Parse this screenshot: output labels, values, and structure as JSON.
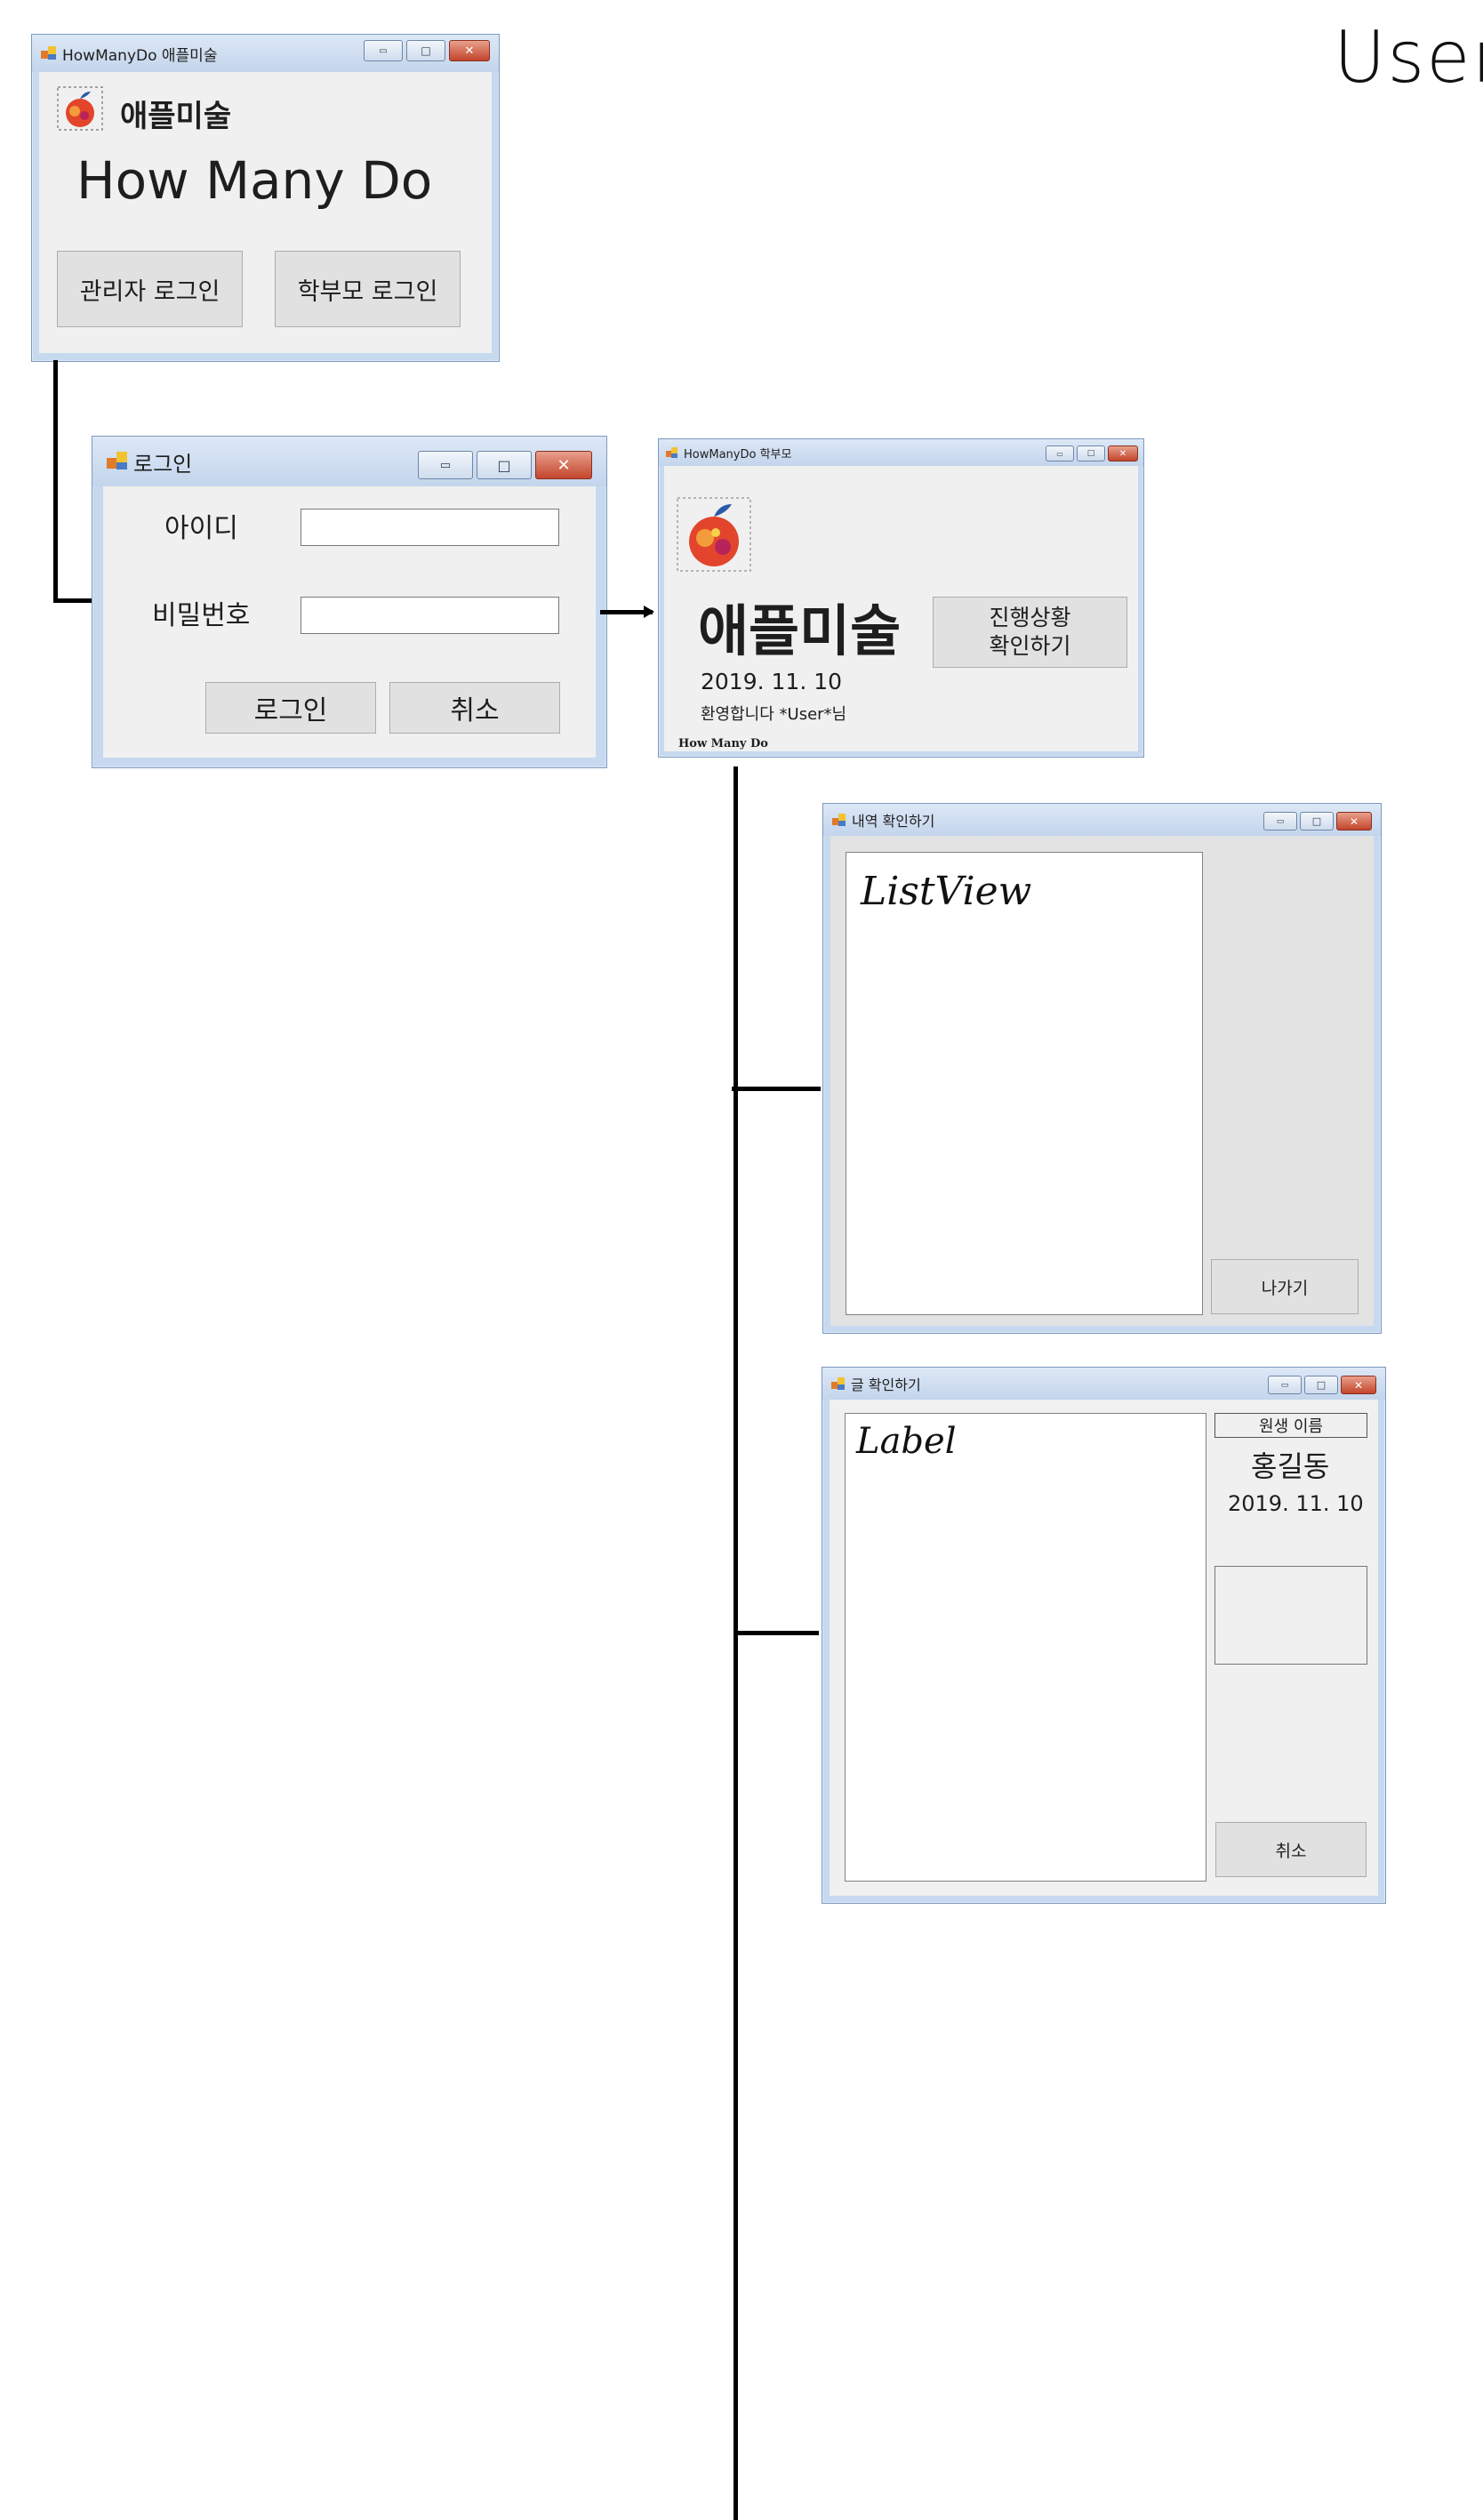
{
  "page": {
    "corner_note": "User"
  },
  "main_window": {
    "title": "HowManyDo 애플미술",
    "brand": "애플미술",
    "headline": "How Many Do",
    "admin_login_button": "관리자 로그인",
    "parent_login_button": "학부모 로그인"
  },
  "login_window": {
    "title": "로그인",
    "id_label": "아이디",
    "id_value": "",
    "password_label": "비밀번호",
    "password_value": "",
    "login_button": "로그인",
    "cancel_button": "취소"
  },
  "parent_window": {
    "title": "HowManyDo 학부모",
    "brand": "애플미술",
    "progress_button_line1": "진행상황",
    "progress_button_line2": "확인하기",
    "date": "2019. 11. 10",
    "welcome": "환영합니다 *User*님",
    "footer": "How Many Do"
  },
  "history_window": {
    "title": "내역 확인하기",
    "listview_note": "ListView",
    "exit_button": "나가기"
  },
  "post_window": {
    "title": "글 확인하기",
    "label_note": "Label",
    "header_field": "원생 이름",
    "student_name": "홍길동",
    "date": "2019. 11. 10",
    "cancel_button": "취소"
  },
  "window_controls": {
    "minimize": "▭",
    "maximize": "□",
    "close": "✕"
  },
  "icon_names": [
    "app-icon",
    "apple-logo-icon",
    "minimize-icon",
    "maximize-icon",
    "close-icon"
  ],
  "colors": {
    "titlebar": "#c3d5ec",
    "client": "#f0f0f0",
    "close_button": "#c3452c",
    "connector": "#000000"
  }
}
